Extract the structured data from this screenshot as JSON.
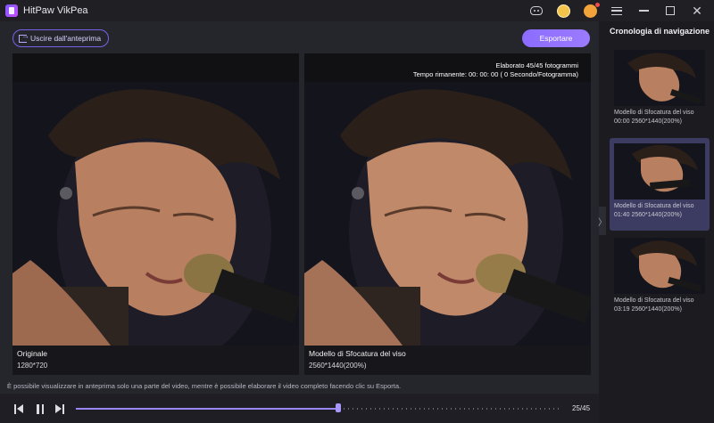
{
  "app": {
    "title": "HitPaw VikPea"
  },
  "titlebar_icons": [
    "discord-icon",
    "coin-icon",
    "avatar-icon",
    "menu-icon",
    "minimize-icon",
    "maximize-icon",
    "close-icon"
  ],
  "toolbar": {
    "exit_label": "Uscire dall'anteprima",
    "export_label": "Esportare"
  },
  "left_panel": {
    "title": "Originale",
    "resolution": "1280*720"
  },
  "right_panel": {
    "title": "Modello di Sfocatura del viso",
    "resolution": "2560*1440(200%)",
    "processed": "Elaborato 45/45 fotogrammi",
    "remaining": "Tempo rimanente: 00: 00: 00 ( 0 Secondo/Fotogramma)"
  },
  "note": "È possibile visualizzare in anteprima solo una parte del video, mentre è possibile elaborare il video completo facendo clic su Esporta.",
  "player": {
    "frame_count": "25/45",
    "progress": 0.54
  },
  "sidebar": {
    "title": "Cronologia di navigazione",
    "items": [
      {
        "line1": "Modello di Sfocatura del viso",
        "line2": "00:00   2560*1440(200%)",
        "active": false
      },
      {
        "line1": "Modello di Sfocatura del viso",
        "line2": "01:40   2560*1440(200%)",
        "active": true
      },
      {
        "line1": "Modello di Sfocatura del viso",
        "line2": "03:19   2560*1440(200%)",
        "active": false
      }
    ]
  },
  "colors": {
    "accent": "#8c6cff",
    "background": "#25252c",
    "sidebar": "#1b1b20",
    "active_item": "#3c3b62"
  }
}
